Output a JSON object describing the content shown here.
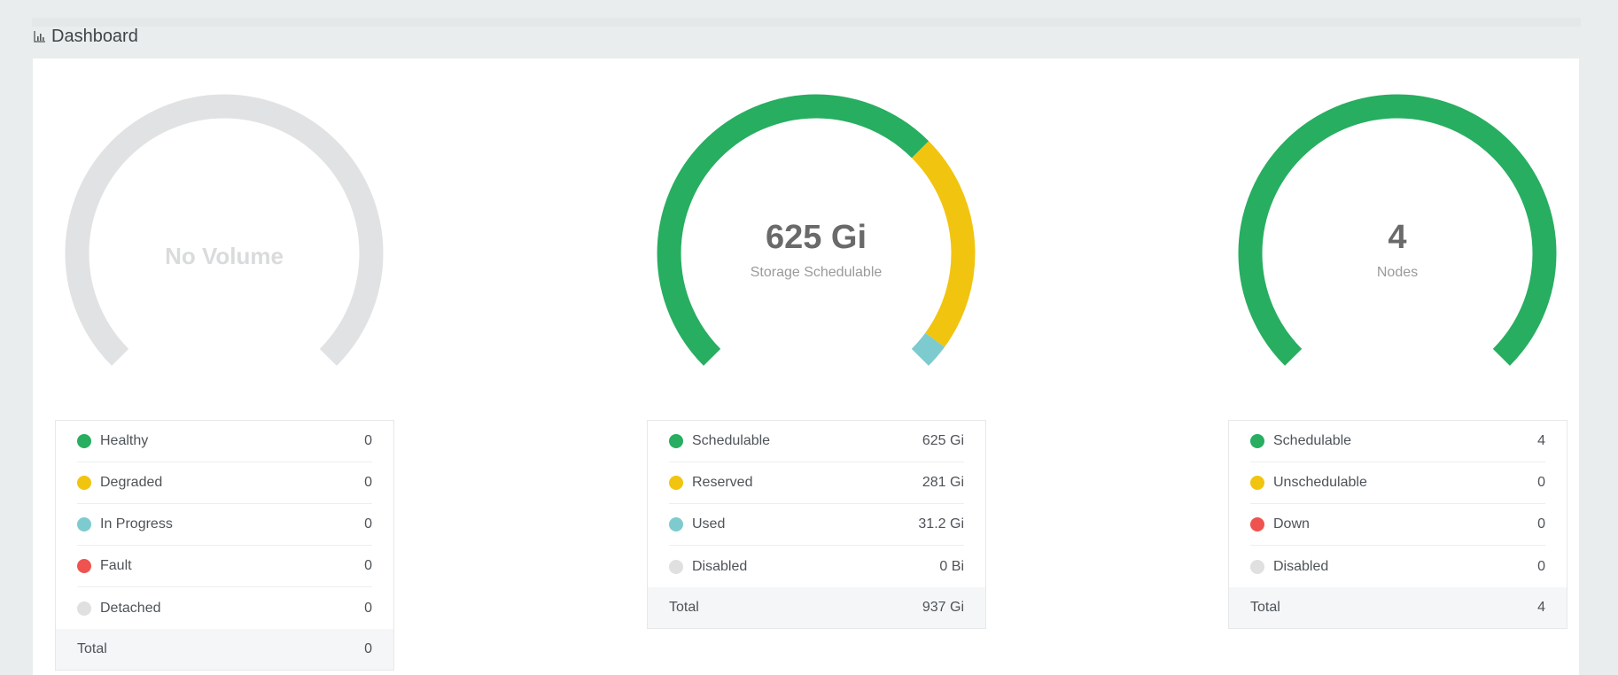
{
  "header": {
    "title": "Dashboard",
    "icon": "bar-chart-icon"
  },
  "colors": {
    "healthy": "#27ae60",
    "degraded": "#f1c40f",
    "in_progress": "#7dcbcf",
    "fault": "#ef5350",
    "disabled": "#e0e0e0",
    "track": "#e1e2e3"
  },
  "volumes": {
    "empty_text": "No Volume",
    "items": [
      {
        "label": "Healthy",
        "value": "0",
        "color": "#27ae60"
      },
      {
        "label": "Degraded",
        "value": "0",
        "color": "#f1c40f"
      },
      {
        "label": "In Progress",
        "value": "0",
        "color": "#7dcbcf"
      },
      {
        "label": "Fault",
        "value": "0",
        "color": "#ef5350"
      },
      {
        "label": "Detached",
        "value": "0",
        "color": "#e0e0e0"
      }
    ],
    "total_label": "Total",
    "total_value": "0"
  },
  "storage": {
    "value": "625 Gi",
    "subtitle": "Storage Schedulable",
    "items": [
      {
        "label": "Schedulable",
        "value": "625 Gi",
        "color": "#27ae60"
      },
      {
        "label": "Reserved",
        "value": "281 Gi",
        "color": "#f1c40f"
      },
      {
        "label": "Used",
        "value": "31.2 Gi",
        "color": "#7dcbcf"
      },
      {
        "label": "Disabled",
        "value": "0 Bi",
        "color": "#e0e0e0"
      }
    ],
    "total_label": "Total",
    "total_value": "937 Gi",
    "fractions": [
      0.667,
      0.3,
      0.033,
      0.0
    ]
  },
  "nodes": {
    "value": "4",
    "subtitle": "Nodes",
    "items": [
      {
        "label": "Schedulable",
        "value": "4",
        "color": "#27ae60"
      },
      {
        "label": "Unschedulable",
        "value": "0",
        "color": "#f1c40f"
      },
      {
        "label": "Down",
        "value": "0",
        "color": "#ef5350"
      },
      {
        "label": "Disabled",
        "value": "0",
        "color": "#e0e0e0"
      }
    ],
    "total_label": "Total",
    "total_value": "4",
    "fractions": [
      1.0,
      0.0,
      0.0,
      0.0
    ]
  }
}
